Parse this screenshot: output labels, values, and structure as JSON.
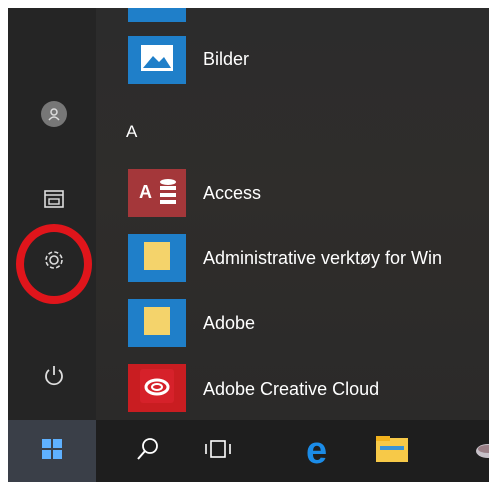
{
  "start_menu": {
    "section_letter": "A",
    "apps": [
      {
        "label": "Bilder",
        "icon": "pictures-icon",
        "tile_color": "#1f7fc9"
      },
      {
        "label": "Access",
        "icon": "access-icon",
        "tile_color": "#a4373a"
      },
      {
        "label": "Administrative verktøy for Win",
        "icon": "folder-icon",
        "tile_color": "#1f7fc9"
      },
      {
        "label": "Adobe",
        "icon": "folder-icon",
        "tile_color": "#1f7fc9"
      },
      {
        "label": "Adobe Creative Cloud",
        "icon": "creative-cloud-icon",
        "tile_color": "#c91d21"
      }
    ]
  },
  "left_rail": {
    "items": [
      "user-account-icon",
      "documents-icon",
      "settings-icon",
      "power-icon"
    ]
  },
  "taskbar": {
    "items": [
      "windows-start-icon",
      "search-icon",
      "task-view-icon",
      "edge-icon",
      "file-explorer-icon"
    ]
  },
  "colors": {
    "annotation_circle": "#e0151b",
    "tile_blue": "#1f7fc9",
    "access_red": "#a4373a"
  }
}
